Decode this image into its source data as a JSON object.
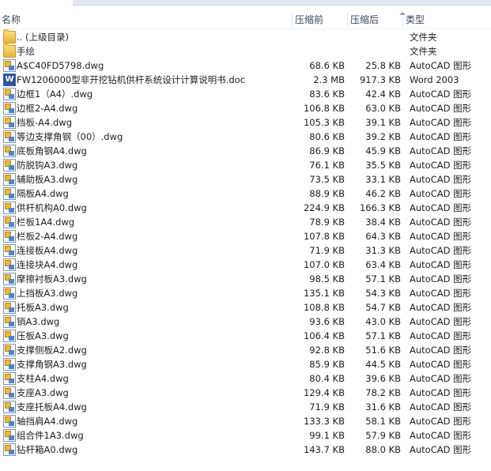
{
  "columns": {
    "name": "名称",
    "size_before": "压缩前",
    "size_after": "压缩后",
    "type": "类型"
  },
  "rows": [
    {
      "name": ".. (上级目录)",
      "before": "",
      "after": "",
      "type": "文件夹",
      "icon": "folder-icon"
    },
    {
      "name": "手绘",
      "before": "",
      "after": "",
      "type": "文件夹",
      "icon": "folder-icon"
    },
    {
      "name": "A$C40FD5798.dwg",
      "before": "68.6 KB",
      "after": "25.8 KB",
      "type": "AutoCAD 图形",
      "icon": "dwg-file-icon"
    },
    {
      "name": "FW1206000型非开挖钻机供杆系统设计计算说明书.doc",
      "before": "2.3 MB",
      "after": "917.3 KB",
      "type": "Word 2003",
      "icon": "word-doc-icon"
    },
    {
      "name": "边框1（A4）.dwg",
      "before": "83.6 KB",
      "after": "42.4 KB",
      "type": "AutoCAD 图形",
      "icon": "dwg-file-icon"
    },
    {
      "name": "边框2-A4.dwg",
      "before": "106.8 KB",
      "after": "63.0 KB",
      "type": "AutoCAD 图形",
      "icon": "dwg-file-icon"
    },
    {
      "name": "挡板-A4.dwg",
      "before": "105.3 KB",
      "after": "39.1 KB",
      "type": "AutoCAD 图形",
      "icon": "dwg-file-icon"
    },
    {
      "name": "等边支撑角钢（00）.dwg",
      "before": "80.6 KB",
      "after": "39.2 KB",
      "type": "AutoCAD 图形",
      "icon": "dwg-file-icon"
    },
    {
      "name": "底板角钢A4.dwg",
      "before": "86.9 KB",
      "after": "45.9 KB",
      "type": "AutoCAD 图形",
      "icon": "dwg-file-icon"
    },
    {
      "name": "防脱钩A3.dwg",
      "before": "76.1 KB",
      "after": "35.5 KB",
      "type": "AutoCAD 图形",
      "icon": "dwg-file-icon"
    },
    {
      "name": "辅助板A3.dwg",
      "before": "73.5 KB",
      "after": "33.1 KB",
      "type": "AutoCAD 图形",
      "icon": "dwg-file-icon"
    },
    {
      "name": "隔板A4.dwg",
      "before": "88.9 KB",
      "after": "46.2 KB",
      "type": "AutoCAD 图形",
      "icon": "dwg-file-icon"
    },
    {
      "name": "供杆机构A0.dwg",
      "before": "224.9 KB",
      "after": "166.3 KB",
      "type": "AutoCAD 图形",
      "icon": "dwg-file-icon"
    },
    {
      "name": "栏板1A4.dwg",
      "before": "78.9 KB",
      "after": "38.4 KB",
      "type": "AutoCAD 图形",
      "icon": "dwg-file-icon"
    },
    {
      "name": "栏板2-A4.dwg",
      "before": "107.8 KB",
      "after": "64.3 KB",
      "type": "AutoCAD 图形",
      "icon": "dwg-file-icon"
    },
    {
      "name": "连接板A4.dwg",
      "before": "71.9 KB",
      "after": "31.3 KB",
      "type": "AutoCAD 图形",
      "icon": "dwg-file-icon"
    },
    {
      "name": "连接块A4.dwg",
      "before": "107.0 KB",
      "after": "63.4 KB",
      "type": "AutoCAD 图形",
      "icon": "dwg-file-icon"
    },
    {
      "name": "摩擦衬板A3.dwg",
      "before": "98.5 KB",
      "after": "57.1 KB",
      "type": "AutoCAD 图形",
      "icon": "dwg-file-icon"
    },
    {
      "name": "上挡板A3.dwg",
      "before": "135.1 KB",
      "after": "54.3 KB",
      "type": "AutoCAD 图形",
      "icon": "dwg-file-icon"
    },
    {
      "name": "托板A3.dwg",
      "before": "108.8 KB",
      "after": "54.7 KB",
      "type": "AutoCAD 图形",
      "icon": "dwg-file-icon"
    },
    {
      "name": "销A3.dwg",
      "before": "93.6 KB",
      "after": "43.0 KB",
      "type": "AutoCAD 图形",
      "icon": "dwg-file-icon"
    },
    {
      "name": "压板A3.dwg",
      "before": "106.4 KB",
      "after": "57.1 KB",
      "type": "AutoCAD 图形",
      "icon": "dwg-file-icon"
    },
    {
      "name": "支撑侧板A2.dwg",
      "before": "92.8 KB",
      "after": "51.6 KB",
      "type": "AutoCAD 图形",
      "icon": "dwg-file-icon"
    },
    {
      "name": "支撑角钢A3.dwg",
      "before": "85.9 KB",
      "after": "44.5 KB",
      "type": "AutoCAD 图形",
      "icon": "dwg-file-icon"
    },
    {
      "name": "支柱A4.dwg",
      "before": "80.4 KB",
      "after": "39.6 KB",
      "type": "AutoCAD 图形",
      "icon": "dwg-file-icon"
    },
    {
      "name": "支座A3.dwg",
      "before": "129.4 KB",
      "after": "78.2 KB",
      "type": "AutoCAD 图形",
      "icon": "dwg-file-icon"
    },
    {
      "name": "支座托板A4.dwg",
      "before": "71.9 KB",
      "after": "31.6 KB",
      "type": "AutoCAD 图形",
      "icon": "dwg-file-icon"
    },
    {
      "name": "轴挡肩A4.dwg",
      "before": "133.3 KB",
      "after": "58.1 KB",
      "type": "AutoCAD 图形",
      "icon": "dwg-file-icon"
    },
    {
      "name": "组合件1A3.dwg",
      "before": "99.1 KB",
      "after": "57.9 KB",
      "type": "AutoCAD 图形",
      "icon": "dwg-file-icon"
    },
    {
      "name": "钻杆箱A0.dwg",
      "before": "143.7 KB",
      "after": "88.0 KB",
      "type": "AutoCAD 图形",
      "icon": "dwg-file-icon"
    }
  ]
}
